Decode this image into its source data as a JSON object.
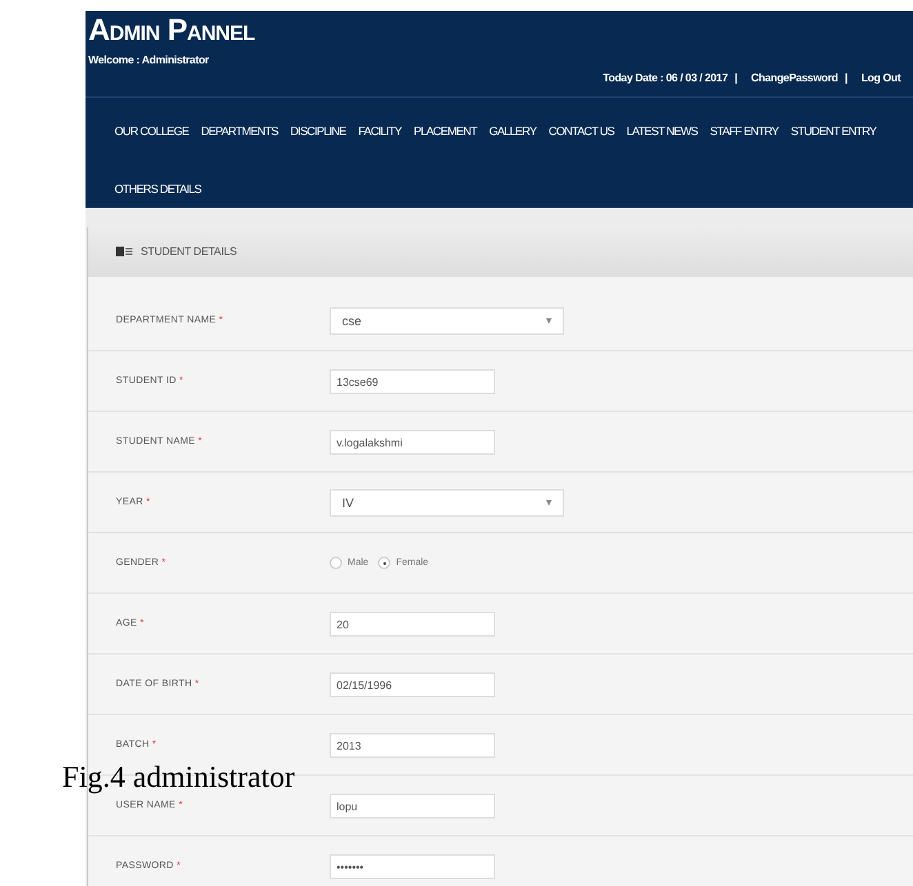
{
  "header": {
    "title": "Admin Pannel",
    "welcome": "Welcome : Administrator",
    "date": "Today Date :  06 / 03 / 2017",
    "separator_1": "|",
    "change_password": "ChangePassword",
    "separator_2": "|",
    "logout": "Log Out"
  },
  "nav": [
    "OUR COLLEGE",
    "DEPARTMENTS",
    "DISCIPLINE",
    "FACILITY",
    "PLACEMENT",
    "GALLERY",
    "CONTACT US",
    "LATEST NEWS",
    "STAFF ENTRY",
    "STUDENT ENTRY",
    "OTHERS DETAILS"
  ],
  "panel": {
    "title": "STUDENT DETAILS",
    "fields": [
      {
        "kind": "select",
        "label": "DEPARTMENT NAME",
        "required": "*",
        "value": "cse"
      },
      {
        "kind": "text",
        "label": "STUDENT ID",
        "required": "*",
        "value": "13cse69"
      },
      {
        "kind": "text",
        "label": "STUDENT NAME",
        "required": "*",
        "value": "v.logalakshmi"
      },
      {
        "kind": "select",
        "label": "YEAR",
        "required": "*",
        "value": "IV"
      },
      {
        "kind": "radio",
        "label": "GENDER",
        "required": "*",
        "options": [
          {
            "label": "Male",
            "selected": false
          },
          {
            "label": "Female",
            "selected": true
          }
        ]
      },
      {
        "kind": "text",
        "label": "AGE",
        "required": "*",
        "value": "20"
      },
      {
        "kind": "text",
        "label": "DATE OF BIRTH",
        "required": "*",
        "value": "02/15/1996"
      },
      {
        "kind": "text",
        "label": "BATCH",
        "required": "*",
        "value": "2013"
      },
      {
        "kind": "text",
        "label": "USER NAME",
        "required": "*",
        "value": "lopu"
      },
      {
        "kind": "text",
        "label": "PASSWORD",
        "required": "*",
        "value": "•••••••"
      }
    ]
  },
  "caption": "Fig.4 administrator"
}
